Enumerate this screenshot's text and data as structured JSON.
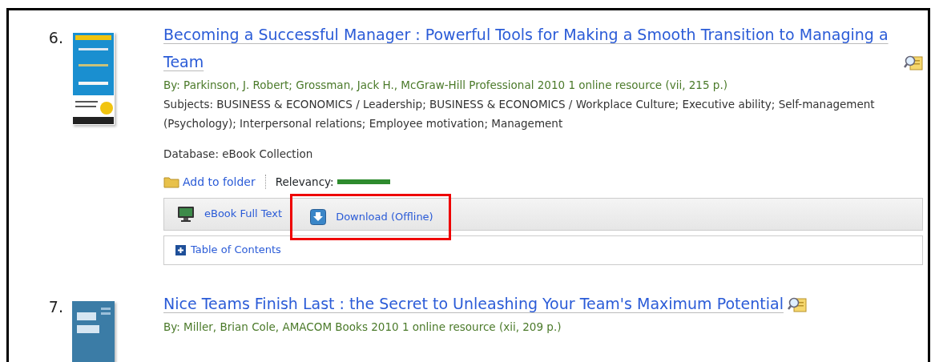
{
  "results": [
    {
      "number": "6.",
      "title": "Becoming a Successful Manager : Powerful Tools for Making a Smooth Transition to Managing a Team",
      "byline": "By: Parkinson, J. Robert; Grossman, Jack H., McGraw-Hill Professional 2010 1 online resource (vii, 215 p.)",
      "subjects": "Subjects: BUSINESS & ECONOMICS / Leadership; BUSINESS & ECONOMICS / Workplace Culture; Executive ability; Self-management (Psychology); Interpersonal relations; Employee motivation; Management",
      "database": "Database: eBook Collection",
      "add_to_folder": "Add to folder",
      "relevancy_label": "Relevancy:",
      "relevancy": {
        "level": 1
      },
      "tabs": [
        {
          "label": "eBook Full Text",
          "kind": "fulltext",
          "highlighted": false
        },
        {
          "label": "Download (Offline)",
          "kind": "download",
          "highlighted": true
        }
      ],
      "toc": "Table of Contents"
    },
    {
      "number": "7.",
      "title": "Nice Teams Finish Last : the Secret to Unleashing Your Team's Maximum Potential",
      "byline": "By: Miller, Brian Cole, AMACOM Books 2010 1 online resource (xii, 209 p.)"
    }
  ]
}
